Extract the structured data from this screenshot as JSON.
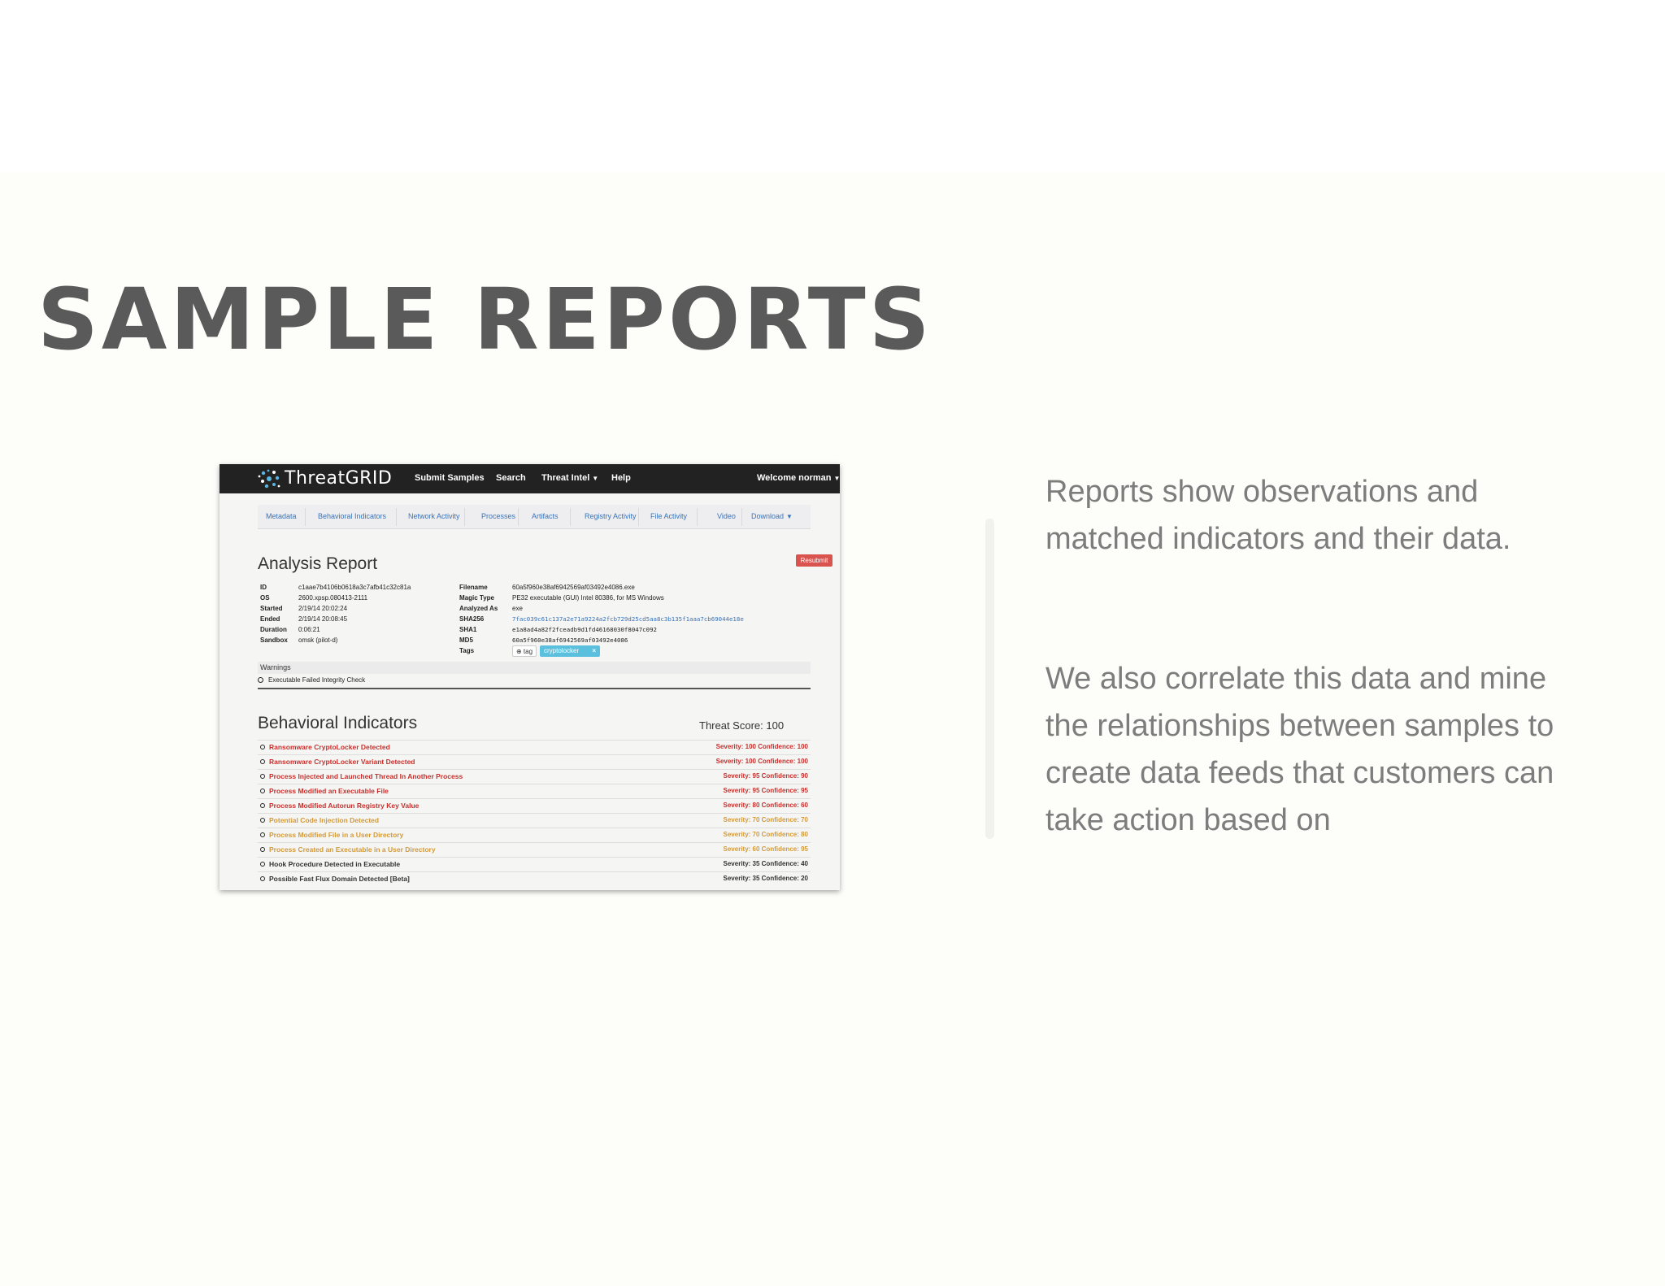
{
  "slide": {
    "title": "SAMPLE REPORTS",
    "paragraphs": [
      "Reports show observations and matched indicators and their data.",
      "We also correlate this data and mine the relationships between samples to create data feeds that customers can take action based on"
    ]
  },
  "app": {
    "brand": "ThreatGRID",
    "nav": [
      "Submit Samples",
      "Search",
      "Threat Intel",
      "Help"
    ],
    "user": "Welcome norman",
    "tabs": [
      "Metadata",
      "Behavioral Indicators",
      "Network Activity",
      "Processes",
      "Artifacts",
      "Registry Activity",
      "File Activity",
      "Video",
      "Download"
    ],
    "report": {
      "title": "Analysis Report",
      "resubmit": "Resubmit",
      "meta_left": [
        {
          "label": "ID",
          "value": "c1aae7b4106b0618a3c7afb41c32c81a"
        },
        {
          "label": "OS",
          "value": "2600.xpsp.080413-2111"
        },
        {
          "label": "Started",
          "value": "2/19/14 20:02:24"
        },
        {
          "label": "Ended",
          "value": "2/19/14 20:08:45"
        },
        {
          "label": "Duration",
          "value": "0:06:21"
        },
        {
          "label": "Sandbox",
          "value": "omsk (pilot-d)"
        }
      ],
      "meta_right": [
        {
          "label": "Filename",
          "value": "60a5f960e38af6942569af03492e4086.exe"
        },
        {
          "label": "Magic Type",
          "value": "PE32 executable (GUI) Intel 80386, for MS Windows"
        },
        {
          "label": "Analyzed As",
          "value": "exe"
        },
        {
          "label": "SHA256",
          "value": "7fac039c61c137a2e71a9224a2fcb729d25cd5aa8c3b135f1aaa7cb69044e18e"
        },
        {
          "label": "SHA1",
          "value": "e1a8ad4a82f2fceadb9d1fd46168030f8047c092"
        },
        {
          "label": "MD5",
          "value": "60a5f960e38af6942569af03492e4086"
        },
        {
          "label": "Tags",
          "value": ""
        }
      ],
      "tag_add": "tag",
      "tag": "cryptolocker",
      "tag_remove": "×",
      "warnings_label": "Warnings",
      "warnings": [
        "Executable Failed Integrity Check"
      ]
    },
    "behavioral": {
      "title": "Behavioral Indicators",
      "threat_score": "Threat Score: 100",
      "indicators": [
        {
          "name": "Ransomware CryptoLocker Detected",
          "score": "Severity: 100 Confidence: 100",
          "color": "#c9302c"
        },
        {
          "name": "Ransomware CryptoLocker Variant Detected",
          "score": "Severity: 100 Confidence: 100",
          "color": "#c9302c"
        },
        {
          "name": "Process Injected and Launched Thread In Another Process",
          "score": "Severity: 95 Confidence: 90",
          "color": "#c9302c"
        },
        {
          "name": "Process Modified an Executable File",
          "score": "Severity: 95 Confidence: 95",
          "color": "#c9302c"
        },
        {
          "name": "Process Modified Autorun Registry Key Value",
          "score": "Severity: 80 Confidence: 60",
          "color": "#c9302c"
        },
        {
          "name": "Potential Code Injection Detected",
          "score": "Severity: 70 Confidence: 70",
          "color": "#d39a3a"
        },
        {
          "name": "Process Modified File in a User Directory",
          "score": "Severity: 70 Confidence: 80",
          "color": "#d39a3a"
        },
        {
          "name": "Process Created an Executable in a User Directory",
          "score": "Severity: 60 Confidence: 95",
          "color": "#d39a3a"
        },
        {
          "name": "Hook Procedure Detected in Executable",
          "score": "Severity: 35 Confidence: 40",
          "color": "#333333"
        },
        {
          "name": "Possible Fast Flux Domain Detected [Beta]",
          "score": "Severity: 35 Confidence: 20",
          "color": "#333333"
        }
      ]
    }
  }
}
